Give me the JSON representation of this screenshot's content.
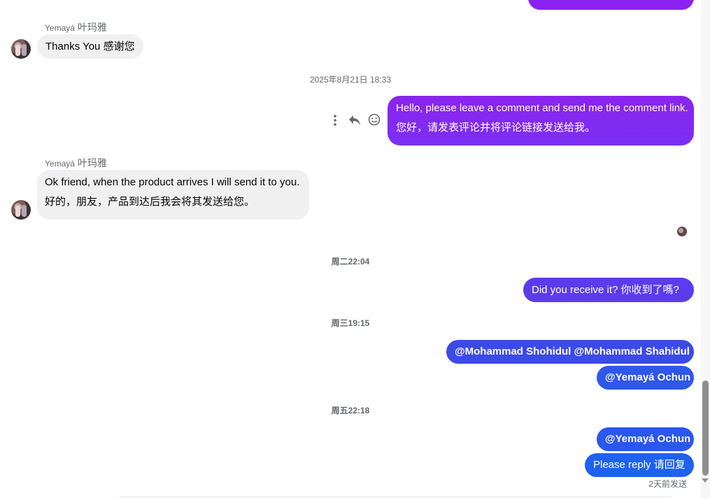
{
  "messages": {
    "msg1": {
      "sender_latin": "Yemayá",
      "sender_cn": "叶玛雅",
      "text": "Thanks You  感谢您"
    },
    "ts1": "2025年8月21日 18:33",
    "msg2": {
      "line1": "Hello, please leave a comment and send me the comment link.",
      "line2": "您好，请发表评论并将评论链接发送给我。"
    },
    "msg3": {
      "sender_latin": "Yemayá",
      "sender_cn": "叶玛雅",
      "line1": "Ok friend, when the product arrives I will send it to you.",
      "line2": "好的，朋友，产品到达后我会将其发送给您。"
    },
    "ts2": "周二22:04",
    "msg4": {
      "text": "Did you receive it?  你收到了嗎?"
    },
    "ts3": "周三19:15",
    "msg5": {
      "text": "@Mohammad Shohidul  @Mohammad Shahidul"
    },
    "msg6": {
      "text": "@Yemayá Ochun"
    },
    "ts4": "周五22:18",
    "msg7": {
      "text": "@Yemayá Ochun"
    },
    "msg8": {
      "text": "Please reply  请回复"
    },
    "status": "2天前发送"
  },
  "icons": {
    "more": "more-vertical-icon",
    "reply": "reply-icon",
    "react": "smiley-icon",
    "avatar": "avatar"
  },
  "colors": {
    "purple": "#8a2be2",
    "indigo": "#5a3df0",
    "blue": "#3b4fe8",
    "blue2": "#1f5cf0",
    "incoming_bg": "#f0f0f0",
    "muted": "#65676b"
  }
}
